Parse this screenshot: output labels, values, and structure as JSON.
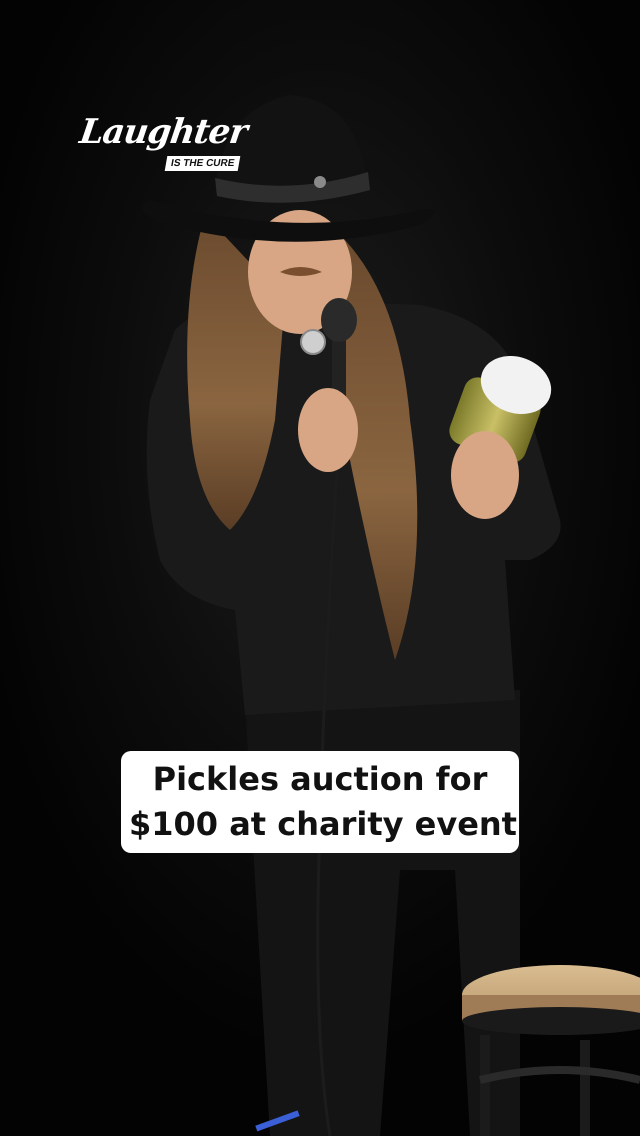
{
  "overlay": {
    "logo": {
      "word": "Laughter",
      "tagline": "IS THE CURE"
    },
    "caption": {
      "line1": "Pickles auction for",
      "line2": "$100 at charity event"
    }
  },
  "scene": {
    "description_icon": "comedian-with-microphone-and-pickle-jar"
  }
}
